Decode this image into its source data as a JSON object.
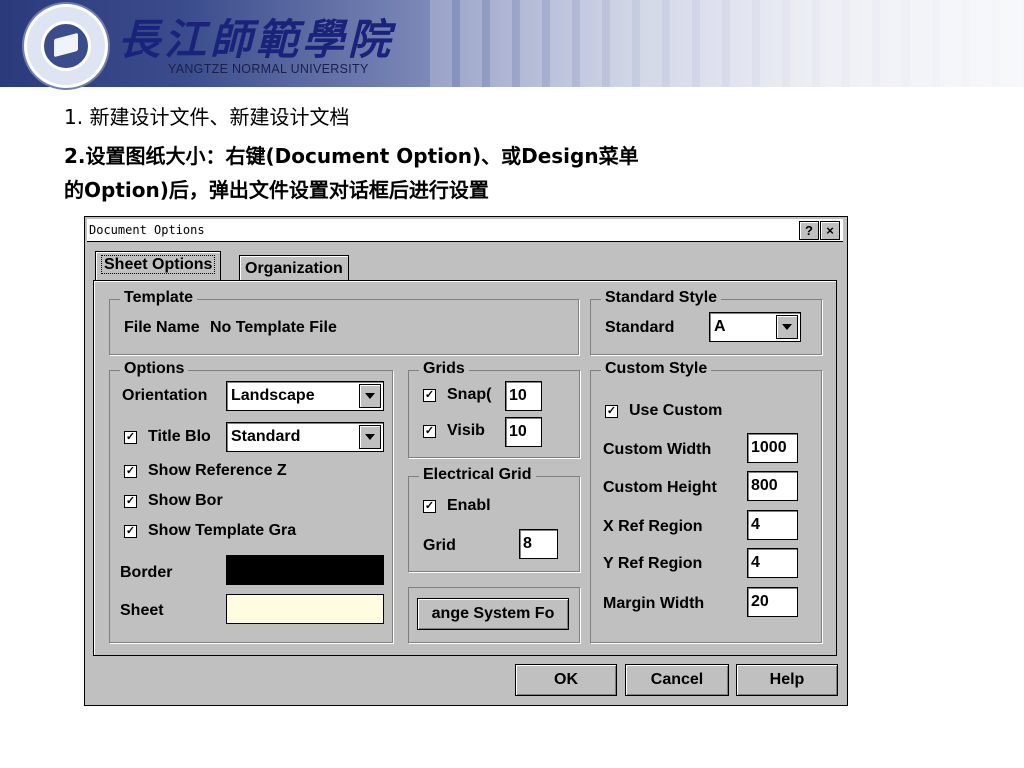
{
  "header": {
    "university_cn": "長江師範學院",
    "university_en": "YANGTZE NORMAL UNIVERSITY"
  },
  "slide": {
    "line1": "1. 新建设计文件、新建设计文档",
    "line2": "2.设置图纸大小：右键(Document Option)、或Design菜单",
    "line3": "的Option)后，弹出文件设置对话框后进行设置"
  },
  "dialog": {
    "title": "Document Options",
    "help_glyph": "?",
    "close_glyph": "×",
    "tabs": [
      "Sheet Options",
      "Organization"
    ],
    "template": {
      "legend": "Template",
      "file_label": "File Name",
      "file_value": "No Template File"
    },
    "standard_style": {
      "legend": "Standard Style",
      "label": "Standard",
      "value": "A"
    },
    "options": {
      "legend": "Options",
      "orientation_label": "Orientation",
      "orientation_value": "Landscape",
      "title_block_label": "Title Blo",
      "title_block_value": "Standard",
      "show_reference_label": "Show Reference Z",
      "show_border_label": "Show Bor",
      "show_template_label": "Show Template Gra",
      "border_label": "Border",
      "sheet_label": "Sheet",
      "border_color": "#000000",
      "sheet_color": "#fffce0",
      "check": "✓"
    },
    "grids": {
      "legend": "Grids",
      "snap_label": "Snap(",
      "snap_value": "10",
      "visible_label": "Visib",
      "visible_value": "10"
    },
    "electrical_grid": {
      "legend": "Electrical Grid",
      "enable_label": "Enabl",
      "grid_label": "Grid",
      "grid_value": "8"
    },
    "change_font_label": "ange System Fo",
    "custom_style": {
      "legend": "Custom Style",
      "use_custom_label": "Use Custom",
      "width_label": "Custom Width",
      "width_value": "1000",
      "height_label": "Custom Height",
      "height_value": "800",
      "xref_label": "X Ref Region",
      "xref_value": "4",
      "yref_label": "Y Ref Region",
      "yref_value": "4",
      "margin_label": "Margin Width",
      "margin_value": "20"
    },
    "buttons": {
      "ok": "OK",
      "cancel": "Cancel",
      "help": "Help"
    }
  }
}
